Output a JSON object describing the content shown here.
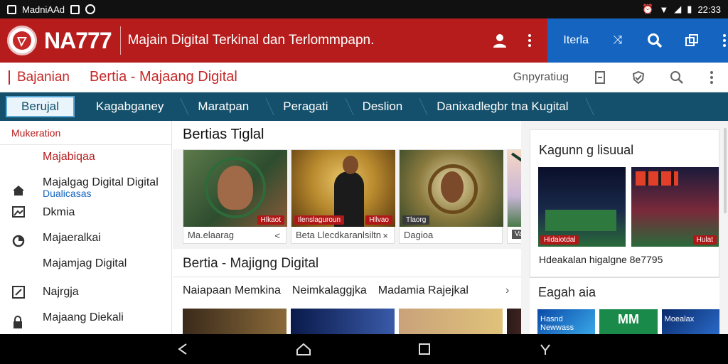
{
  "status": {
    "app_label": "MadniAAd",
    "time": "22:33"
  },
  "header": {
    "brand": "NA777",
    "tagline": "Majain Digital Terkinal dan Terlommpapn.",
    "blue_label": "Iterla"
  },
  "breadcrumb": {
    "first": "Bajanian",
    "current": "Bertia - Majaang Digital",
    "right_text": "Gnpyratiug"
  },
  "tabs": [
    {
      "label": "Berujal",
      "active": true
    },
    {
      "label": "Kagabganey",
      "active": false
    },
    {
      "label": "Maratpan",
      "active": false
    },
    {
      "label": "Peragati",
      "active": false
    },
    {
      "label": "Deslion",
      "active": false
    },
    {
      "label": "Danixadlegbr tna Kugital",
      "active": false
    }
  ],
  "sidebar": {
    "heading": "Mukeration",
    "items": [
      {
        "label": "Majabiqaa",
        "icon": "none"
      },
      {
        "label": "Majalgag Digital Digital",
        "sub": "Dualicasas",
        "icon": "home-icon"
      },
      {
        "label": "Dkmia",
        "icon": "image-icon"
      },
      {
        "label": "Majaeralkai",
        "icon": "pie-icon"
      },
      {
        "label": "Majamjag Digital",
        "icon": "none"
      },
      {
        "label": "Najrgja",
        "icon": "edit-icon"
      },
      {
        "label": "Majaang Diekali",
        "icon": "lock-icon"
      }
    ]
  },
  "main": {
    "section1_title": "Bertias Tiglal",
    "thumbs": [
      {
        "badge": "Hlkaot",
        "caption": "Ma.elaarag",
        "x": "<"
      },
      {
        "badge": "Ilenslaguroun",
        "badge2": "Hllvao",
        "caption": "Beta Llecdkaranlsiltn",
        "x": "×"
      },
      {
        "badge": "Tlaorg",
        "caption": "Dagioa"
      },
      {
        "badge": "Vatemoia"
      }
    ],
    "section2_title": "Bertia - Majigng Digital",
    "links": [
      "Naiapaan Memkina",
      "Neimkalaggjka",
      "Madamia Rajejkal"
    ]
  },
  "right": {
    "card1_title": "Kagunn g lisuual",
    "img1_badge": "Hidaiotdal",
    "img2_badge": "Hulat",
    "caption": "Hdeakalan higalgne 8e7795",
    "card2_title": "Eagah aia",
    "mini": [
      "Hasnd Newwass",
      "MM",
      "Moealax"
    ]
  },
  "colors": {
    "brand_red": "#b61c1c",
    "header_blue": "#1565c0",
    "tab_teal": "#14506b"
  }
}
